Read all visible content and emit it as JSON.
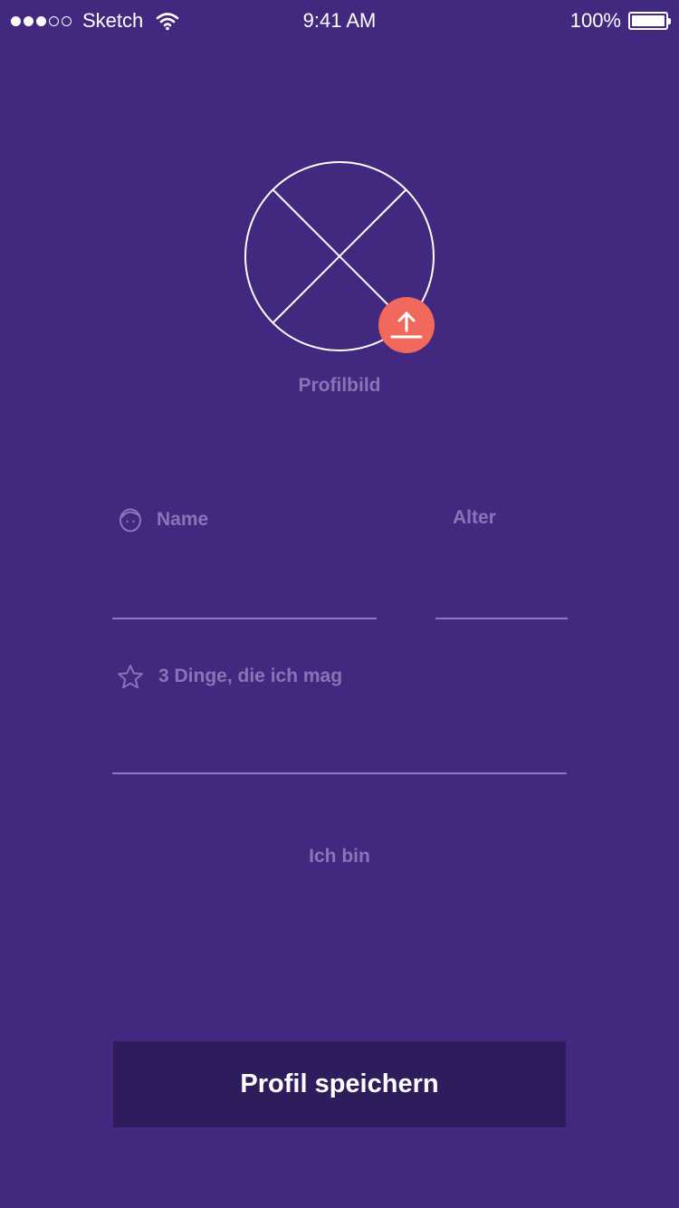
{
  "status_bar": {
    "carrier": "Sketch",
    "time": "9:41 AM",
    "battery": "100%",
    "signal_bars_filled": 3,
    "signal_bars_total": 5
  },
  "profile_picture": {
    "label": "Profilbild",
    "upload_icon": "upload-arrow-icon",
    "upload_color": "#f0695c"
  },
  "form": {
    "name_label": "Name",
    "name_icon": "face-icon",
    "name_value": "",
    "age_label": "Alter",
    "age_value": "",
    "likes_label": "3 Dinge, die ich mag",
    "likes_icon": "star-icon",
    "likes_value": "",
    "gender_label": "Ich bin"
  },
  "save_button": {
    "label": "Profil speichern"
  },
  "colors": {
    "background": "#42297f",
    "button": "#2e1c5d",
    "muted_text": "#8a74b8",
    "accent": "#f0695c"
  }
}
